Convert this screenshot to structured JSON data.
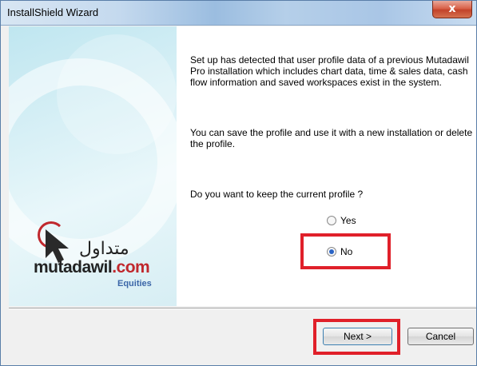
{
  "window": {
    "title": "InstallShield Wizard",
    "close_glyph": "x"
  },
  "logo": {
    "arabic": "متداول",
    "name_main": "mutadawil",
    "name_suffix": ".com",
    "subtitle": "Equities"
  },
  "content": {
    "paragraph1": "Set up has detected that user profile data of a previous Mutadawil Pro installation which includes chart data, time & sales data, cash flow information and saved workspaces exist in the system.",
    "paragraph2": "You can save the profile and use it with a new installation or delete the profile.",
    "question": "Do you want to keep the current profile ?",
    "options": [
      {
        "label": "Yes",
        "checked": false
      },
      {
        "label": "No",
        "checked": true
      }
    ]
  },
  "buttons": {
    "next": "Next >",
    "cancel": "Cancel"
  },
  "colors": {
    "highlight": "#e0202a",
    "radio_selected": "#2a64c5",
    "brand_red": "#c0282d",
    "brand_blue": "#3b66a8"
  }
}
